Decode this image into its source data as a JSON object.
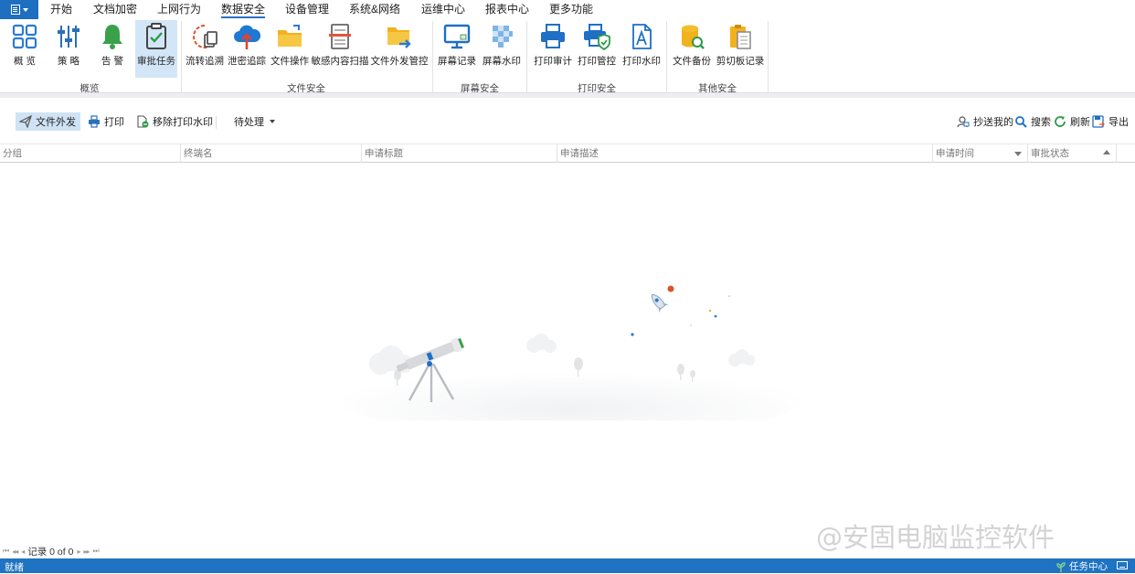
{
  "menu": {
    "items": [
      "开始",
      "文档加密",
      "上网行为",
      "数据安全",
      "设备管理",
      "系统&网络",
      "运维中心",
      "报表中心",
      "更多功能"
    ],
    "active": "数据安全"
  },
  "ribbon": {
    "buttons": {
      "overview": "概 览",
      "policy": "策 略",
      "alert": "告 警",
      "approval_task": "审批任务",
      "flow_trace": "流转追溯",
      "leak_trace": "泄密追踪",
      "file_ops": "文件操作",
      "sensitive_scan": "敏感内容扫描",
      "file_send_ctrl": "文件外发管控",
      "screen_record": "屏幕记录",
      "screen_watermark": "屏幕水印",
      "print_audit": "打印审计",
      "print_ctrl": "打印管控",
      "print_watermark": "打印水印",
      "file_backup": "文件备份",
      "clipboard_log": "剪切板记录"
    },
    "groups": {
      "overview": "概览",
      "file_security": "文件安全",
      "screen_security": "屏幕安全",
      "print_security": "打印安全",
      "other_security": "其他安全"
    }
  },
  "toolbar": {
    "file_send": "文件外发",
    "print": "打印",
    "remove_print_watermark": "移除打印水印",
    "pending": "待处理",
    "cc_me": "抄送我的",
    "search": "搜索",
    "refresh": "刷新",
    "export": "导出"
  },
  "grid": {
    "columns": [
      "分组",
      "终端名",
      "申请标题",
      "申请描述",
      "申请时间",
      "审批状态"
    ]
  },
  "pager": {
    "records": "记录 0 of 0"
  },
  "watermark": "@安固电脑监控软件",
  "statusbar": {
    "status": "就绪",
    "task_center": "任务中心"
  },
  "colors": {
    "accent": "#1e73c3",
    "selected_bg": "#d3e6f7"
  }
}
